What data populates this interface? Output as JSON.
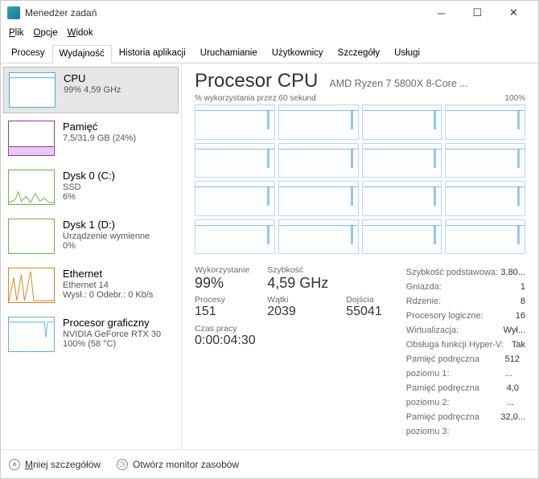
{
  "window": {
    "title": "Menedżer zadań"
  },
  "menu": {
    "file": "Plik",
    "options": "Opcje",
    "view": "Widok"
  },
  "tabs": {
    "processes": "Procesy",
    "performance": "Wydajność",
    "app_history": "Historia aplikacji",
    "startup": "Uruchamianie",
    "users": "Użytkownicy",
    "details": "Szczegóły",
    "services": "Usługi"
  },
  "sidebar": {
    "cpu": {
      "title": "CPU",
      "sub": "99%   4,59 GHz"
    },
    "mem": {
      "title": "Pamięć",
      "sub": "7,5/31,9 GB (24%)"
    },
    "disk0": {
      "title": "Dysk 0 (C:)",
      "sub1": "SSD",
      "sub2": "6%"
    },
    "disk1": {
      "title": "Dysk 1 (D:)",
      "sub1": "Urządzenie wymienne",
      "sub2": "0%"
    },
    "eth": {
      "title": "Ethernet",
      "sub1": "Ethernet 14",
      "sub2": "Wysł.: 0 Odebr.: 0 Kb/s"
    },
    "gpu": {
      "title": "Procesor graficzny",
      "sub1": "NVIDIA GeForce RTX 30",
      "sub2": "100%  (58 °C)"
    }
  },
  "main": {
    "title": "Procesor CPU",
    "subtitle": "AMD Ryzen 7 5800X 8-Core ...",
    "chart_label_left": "% wykorzystania przez 60 sekund",
    "chart_label_right": "100%"
  },
  "stats": {
    "util_lbl": "Wykorzystanie",
    "util_val": "99%",
    "speed_lbl": "Szybkość",
    "speed_val": "4,59 GHz",
    "proc_lbl": "Procesy",
    "proc_val": "151",
    "threads_lbl": "Wątki",
    "threads_val": "2039",
    "handles_lbl": "Dojścia",
    "handles_val": "55041",
    "uptime_lbl": "Czas pracy",
    "uptime_val": "0:00:04:30"
  },
  "info": {
    "base_lbl": "Szybkość podstawowa:",
    "base_val": "3,80...",
    "sockets_lbl": "Gniazda:",
    "sockets_val": "1",
    "cores_lbl": "Rdzenie:",
    "cores_val": "8",
    "logical_lbl": "Procesory logiczne:",
    "logical_val": "16",
    "virt_lbl": "Wirtualizacja:",
    "virt_val": "Wył...",
    "hyperv_lbl": "Obsługa funkcji Hyper-V:",
    "hyperv_val": "Tak",
    "l1_lbl": "Pamięć podręczna poziomu 1:",
    "l1_val": "512 ...",
    "l2_lbl": "Pamięć podręczna poziomu 2:",
    "l2_val": "4,0 ...",
    "l3_lbl": "Pamięć podręczna poziomu 3:",
    "l3_val": "32,0..."
  },
  "footer": {
    "details": "Mniej szczegółów",
    "resmon": "Otwórz monitor zasobów"
  },
  "chart_data": {
    "type": "area",
    "title": "CPU utilization per logical processor over 60 seconds",
    "xlabel": "seconds",
    "ylabel": "% utilization",
    "xlim": [
      0,
      60
    ],
    "ylim": [
      0,
      100
    ],
    "series_count": 16,
    "note": "All 16 logical processors near 100% with brief dips",
    "representative_values": [
      98,
      99,
      97,
      100,
      95,
      98,
      99,
      96,
      100,
      99,
      97,
      98,
      99,
      100,
      94,
      99
    ]
  }
}
